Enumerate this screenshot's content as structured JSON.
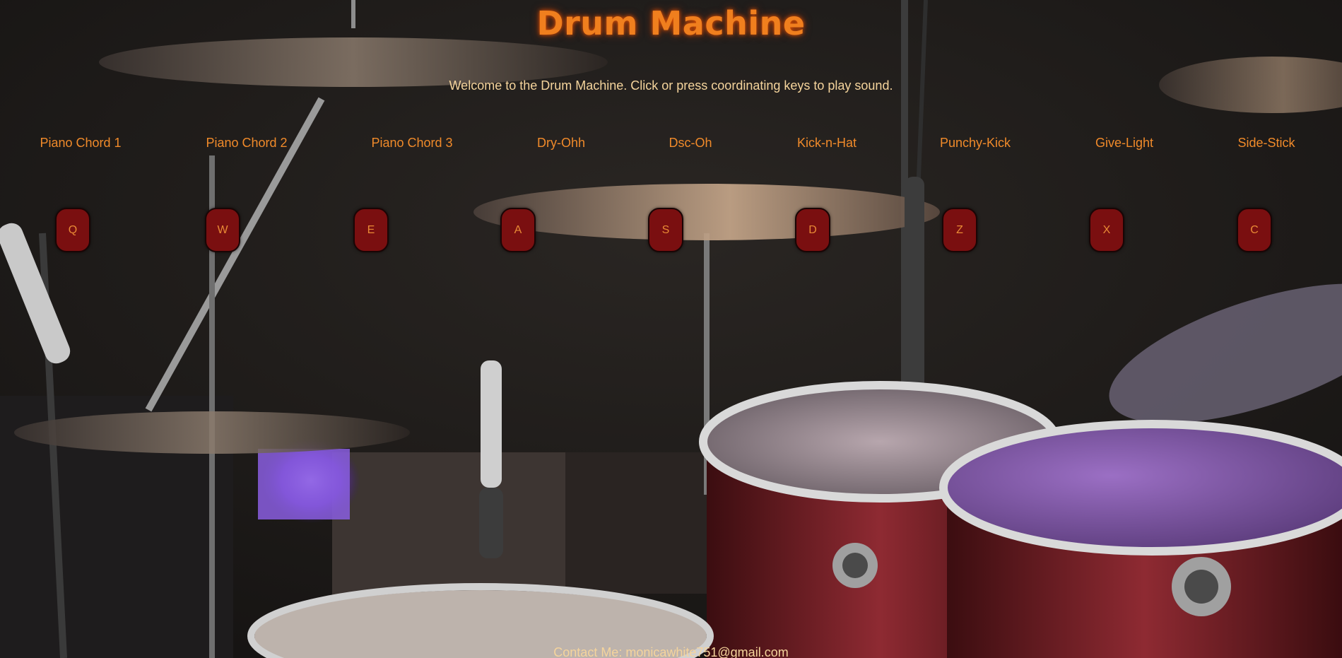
{
  "header": {
    "title": "Drum Machine",
    "welcome": "Welcome to the Drum Machine. Click or press coordinating keys to play sound."
  },
  "sounds": [
    {
      "name": "Piano Chord 1",
      "key": "Q"
    },
    {
      "name": "Piano Chord 2",
      "key": "W"
    },
    {
      "name": "Piano Chord 3",
      "key": "E"
    },
    {
      "name": "Dry-Ohh",
      "key": "A"
    },
    {
      "name": "Dsc-Oh",
      "key": "S"
    },
    {
      "name": "Kick-n-Hat",
      "key": "D"
    },
    {
      "name": "Punchy-Kick",
      "key": "Z"
    },
    {
      "name": "Give-Light",
      "key": "X"
    },
    {
      "name": "Side-Stick",
      "key": "C"
    }
  ],
  "footer": {
    "contact": "Contact Me: monicawhite751@gmail.com"
  },
  "colors": {
    "title": "#f07f1e",
    "label": "#f08a2a",
    "pad": "#7a0f10",
    "pad_text": "#e88a35",
    "body_text": "#f5d49c"
  }
}
